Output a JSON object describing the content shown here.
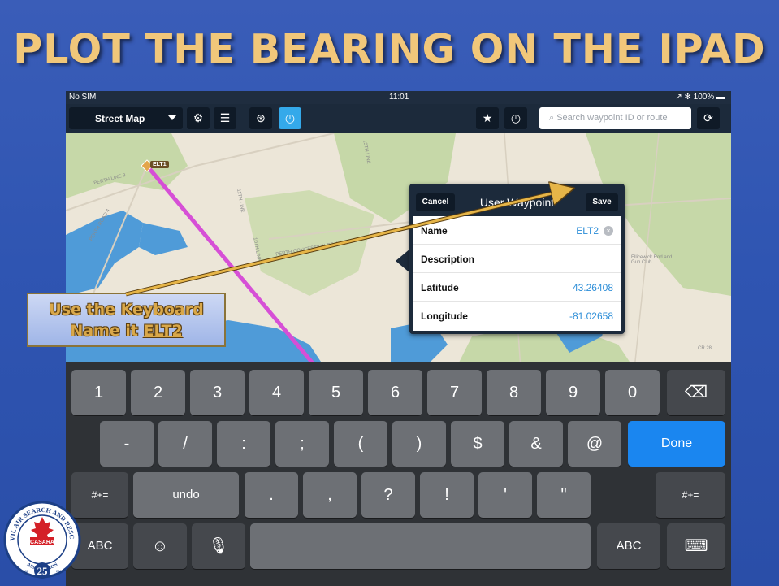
{
  "slide": {
    "title": "PLOT THE BEARING ON THE IPAD",
    "callout_line1": "Use the Keyboard",
    "callout_line2_prefix": "Name it ",
    "callout_line2_value": "ELT2"
  },
  "status_bar": {
    "carrier": "No SIM",
    "time": "11:01",
    "battery": "↗ ✻ 100% ▬"
  },
  "toolbar": {
    "map_type": "Street Map",
    "buttons": [
      "settings-icon",
      "layers-icon",
      "compass-icon",
      "timer-icon",
      "favorites-icon",
      "clock-icon",
      "refresh-icon"
    ],
    "search_placeholder": "Search waypoint ID or route",
    "active_color": "#34a9ea"
  },
  "map": {
    "waypoint_label": "ELT1",
    "labels": [
      "PERTH LINE 9",
      "PERTH ROAD 4",
      "PERTH CONCESSION RD 4",
      "Ellicewick Rod and Gun Club",
      "CR 28",
      "11TH LINE",
      "13TH LINE",
      "10TH LINE"
    ],
    "route_color": "#d64fd6",
    "water_color": "#4f9bd8",
    "forest_color": "#c6d8a8"
  },
  "popover": {
    "cancel_label": "Cancel",
    "title": "User Waypoint",
    "save_label": "Save",
    "rows": [
      {
        "label": "Name",
        "value": "ELT2"
      },
      {
        "label": "Description",
        "value": ""
      },
      {
        "label": "Latitude",
        "value": "43.26408"
      },
      {
        "label": "Longitude",
        "value": "-81.02658"
      }
    ]
  },
  "keyboard": {
    "row1": [
      "1",
      "2",
      "3",
      "4",
      "5",
      "6",
      "7",
      "8",
      "9",
      "0"
    ],
    "row2": [
      "-",
      "/",
      ":",
      ";",
      "(",
      ")",
      "$",
      "&",
      "@"
    ],
    "row2_action": "Done",
    "row3_left": "#+=",
    "row3_undo": "undo",
    "row3": [
      ".",
      ",",
      "?",
      "!",
      "'",
      "\""
    ],
    "row3_right": "#+=",
    "row4_left": "ABC",
    "row4_right": "ABC",
    "done_color": "#1a86f0"
  },
  "logo": {
    "text_top": "CIVIL AIR SEARCH AND RESCUE",
    "text_center": "CASARA",
    "text_bottom": "ASSOCIATION",
    "year_left": "1986",
    "year_right": "2011",
    "anniversary": "25"
  }
}
